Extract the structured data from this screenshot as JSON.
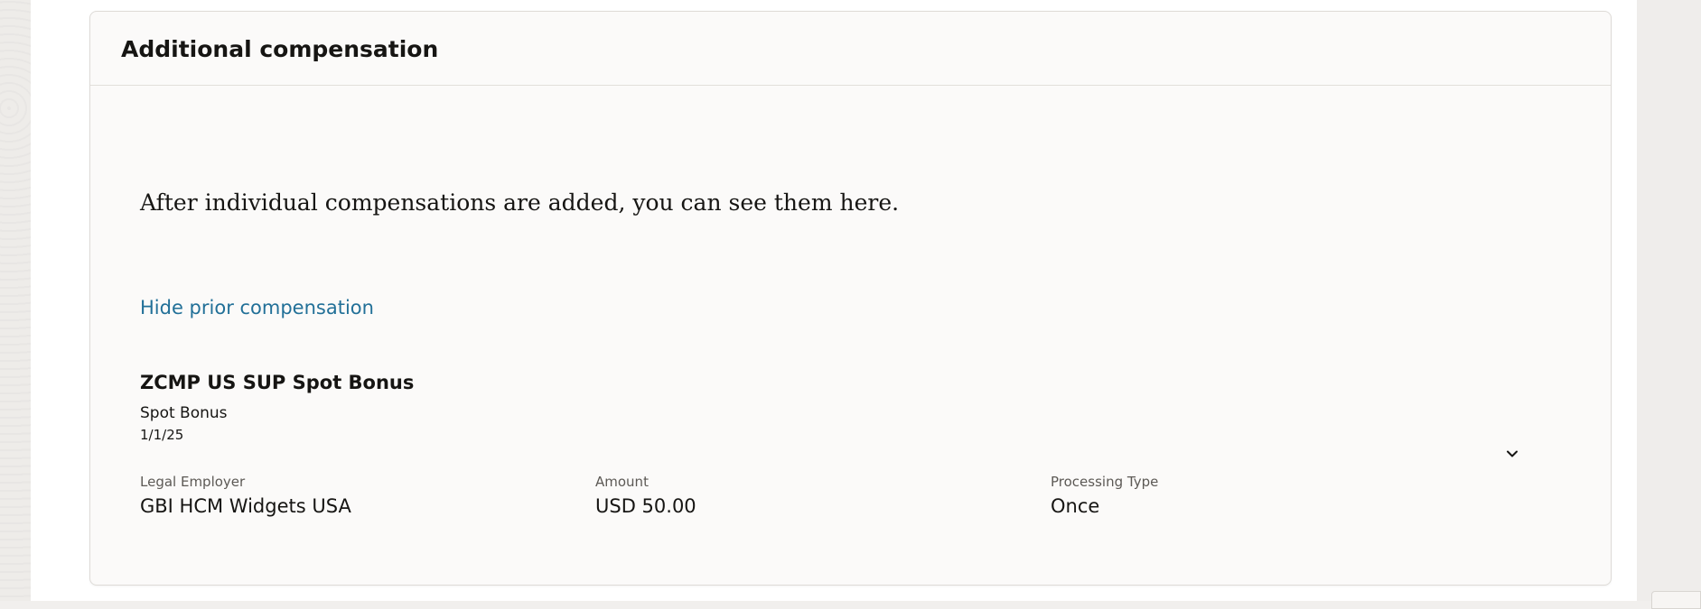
{
  "section": {
    "title": "Additional compensation",
    "empty_message": "After individual compensations are added, you can see them here.",
    "toggle_link_label": "Hide prior compensation"
  },
  "compensation": {
    "name": "ZCMP US SUP Spot Bonus",
    "type": "Spot Bonus",
    "date": "1/1/25",
    "fields": [
      {
        "label": "Legal Employer",
        "value": "GBI HCM Widgets USA"
      },
      {
        "label": "Amount",
        "value": "USD 50.00"
      },
      {
        "label": "Processing Type",
        "value": "Once"
      }
    ],
    "expand_icon": "chevron-down-icon"
  },
  "colors": {
    "link": "#227098",
    "text": "#161513",
    "label": "#5c5955",
    "card_background": "#fbfaf9",
    "page_background": "#ffffff"
  }
}
